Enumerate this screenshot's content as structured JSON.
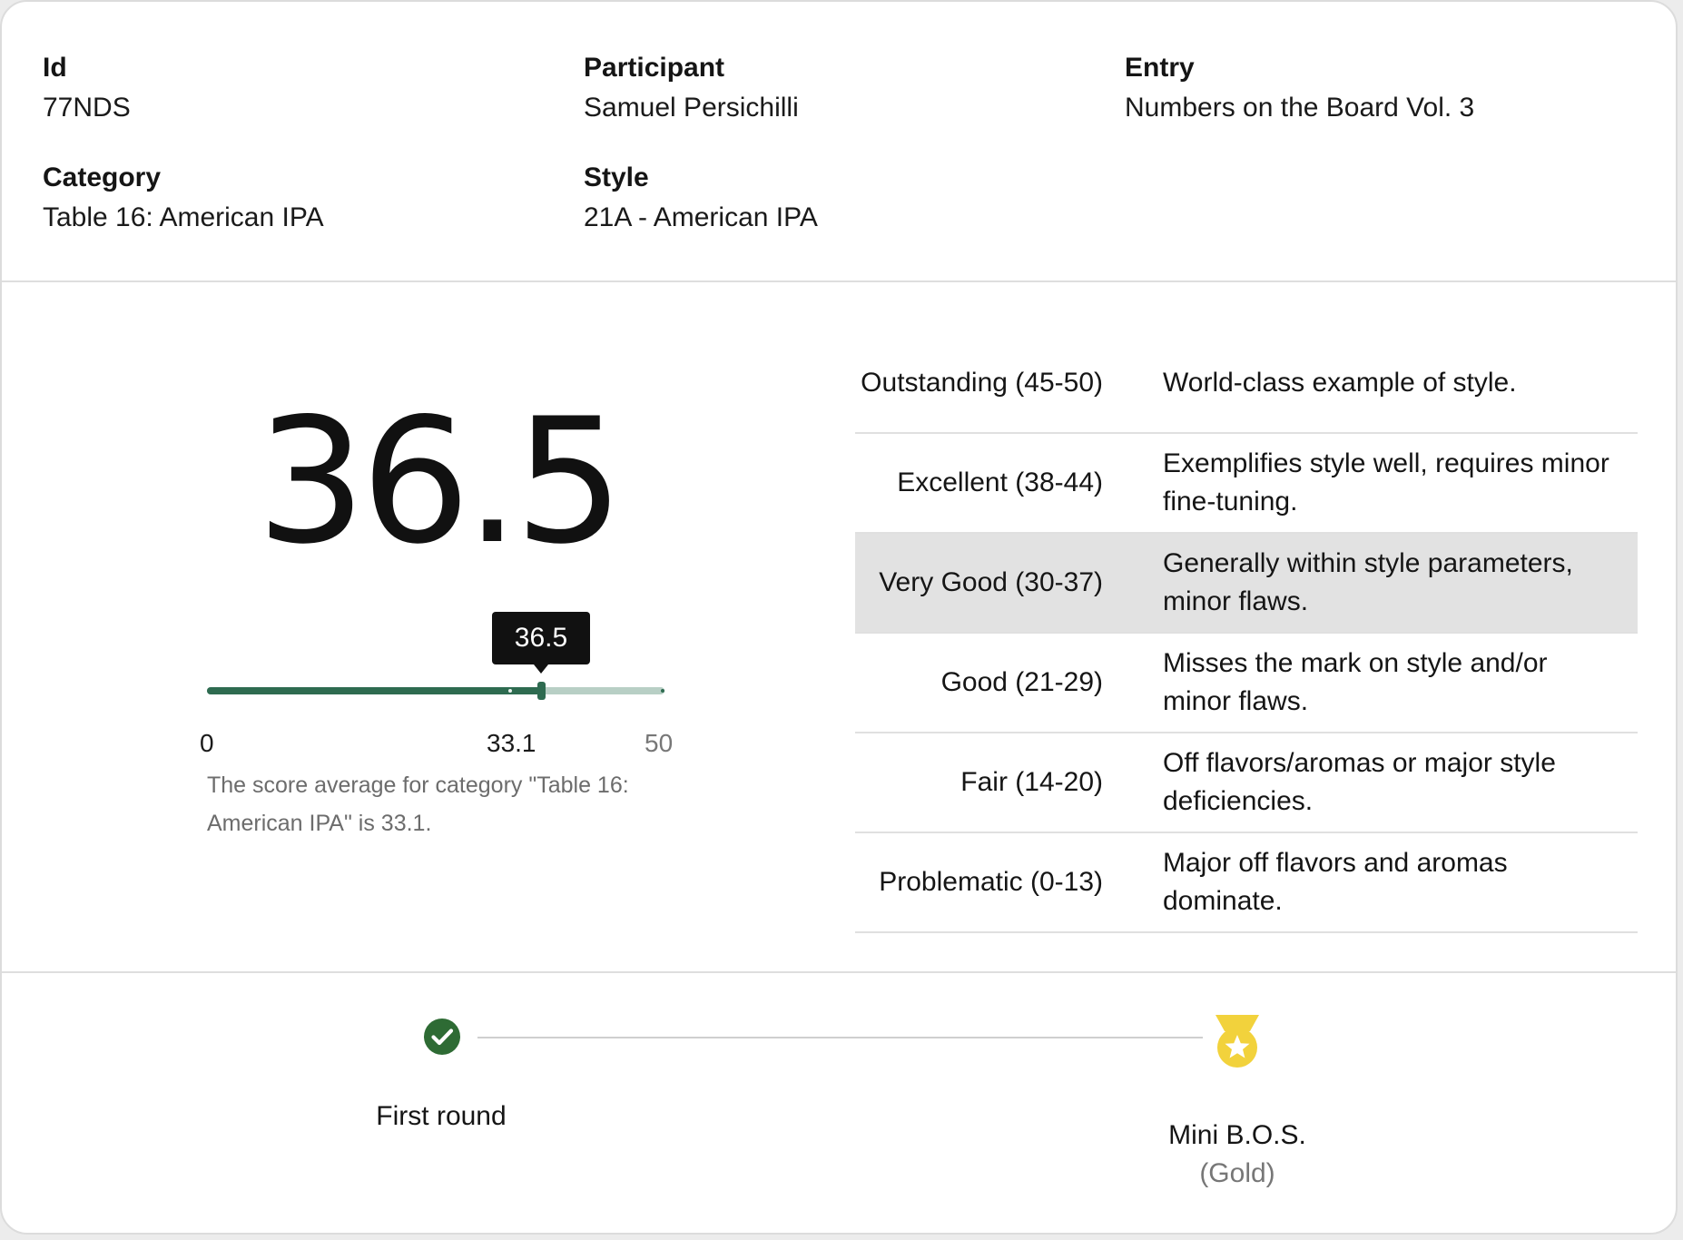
{
  "info": {
    "id": {
      "label": "Id",
      "value": "77NDS"
    },
    "participant": {
      "label": "Participant",
      "value": "Samuel Persichilli"
    },
    "entry": {
      "label": "Entry",
      "value": "Numbers on the Board Vol. 3"
    },
    "category": {
      "label": "Category",
      "value": "Table 16: American IPA"
    },
    "style": {
      "label": "Style",
      "value": "21A - American IPA"
    }
  },
  "score": {
    "value": "36.5",
    "slider": {
      "min": 0,
      "max": 50,
      "value": 36.5,
      "average": 33.1,
      "min_label": "0",
      "avg_label": "33.1",
      "max_label": "50",
      "tooltip": "36.5"
    },
    "note": "The score average for category \"Table 16: American IPA\" is 33.1.",
    "colors": {
      "accent": "#2e6b50",
      "track": "#b8cfc5"
    }
  },
  "scale": [
    {
      "label": "Outstanding (45-50)",
      "desc": "World-class example of style.",
      "highlight": false
    },
    {
      "label": "Excellent (38-44)",
      "desc": "Exemplifies style well, requires minor fine-tuning.",
      "highlight": false
    },
    {
      "label": "Very Good (30-37)",
      "desc": "Generally within style parameters, minor flaws.",
      "highlight": true
    },
    {
      "label": "Good (21-29)",
      "desc": "Misses the mark on style and/or minor flaws.",
      "highlight": false
    },
    {
      "label": "Fair (14-20)",
      "desc": "Off flavors/aromas or major style deficiencies.",
      "highlight": false
    },
    {
      "label": "Problematic (0-13)",
      "desc": "Major off flavors and aromas dominate.",
      "highlight": false
    }
  ],
  "progress": {
    "steps": [
      {
        "label": "First round",
        "icon": "check-circle-icon",
        "color": "#2e6b34"
      },
      {
        "label": "Mini B.O.S.",
        "sub": "(Gold)",
        "icon": "gold-medal-icon",
        "color": "#f2d23c"
      }
    ]
  }
}
